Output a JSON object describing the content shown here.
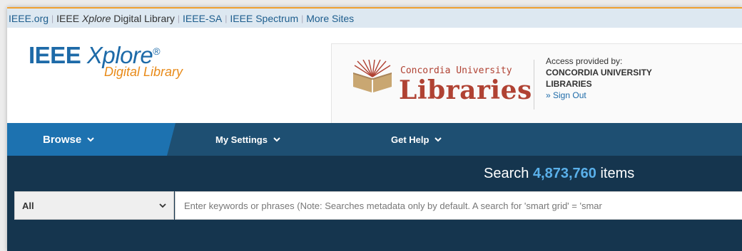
{
  "topbar": {
    "links": [
      {
        "label": "IEEE.org"
      },
      {
        "pre": "IEEE ",
        "em": "Xplore",
        "post": " Digital Library"
      },
      {
        "label": "IEEE-SA"
      },
      {
        "label": "IEEE Spectrum"
      },
      {
        "label": "More Sites"
      }
    ]
  },
  "logo": {
    "prefix": "IEEE ",
    "name": "Xplore",
    "reg": "®",
    "subtitle": "Digital Library"
  },
  "institution": {
    "small": "Concordia University",
    "big": "Libraries",
    "access_label": "Access provided by:",
    "org_line1": "CONCORDIA UNIVERSITY",
    "org_line2": "LIBRARIES",
    "sign_out": "» Sign Out"
  },
  "nav": {
    "browse": "Browse",
    "settings": "My Settings",
    "help": "Get Help"
  },
  "search": {
    "title_prefix": "Search ",
    "count": "4,873,760",
    "title_suffix": " items",
    "scope": "All",
    "placeholder": "Enter keywords or phrases (Note: Searches metadata only by default. A search for 'smart grid' = 'smar"
  },
  "colors": {
    "brand_blue": "#1d6aa8",
    "brand_orange": "#e88a18",
    "nav_bg": "#1e4f72",
    "nav_active": "#1d72b0",
    "search_bg": "#15354e",
    "count_color": "#5ab0ea",
    "library_red": "#b04233"
  }
}
